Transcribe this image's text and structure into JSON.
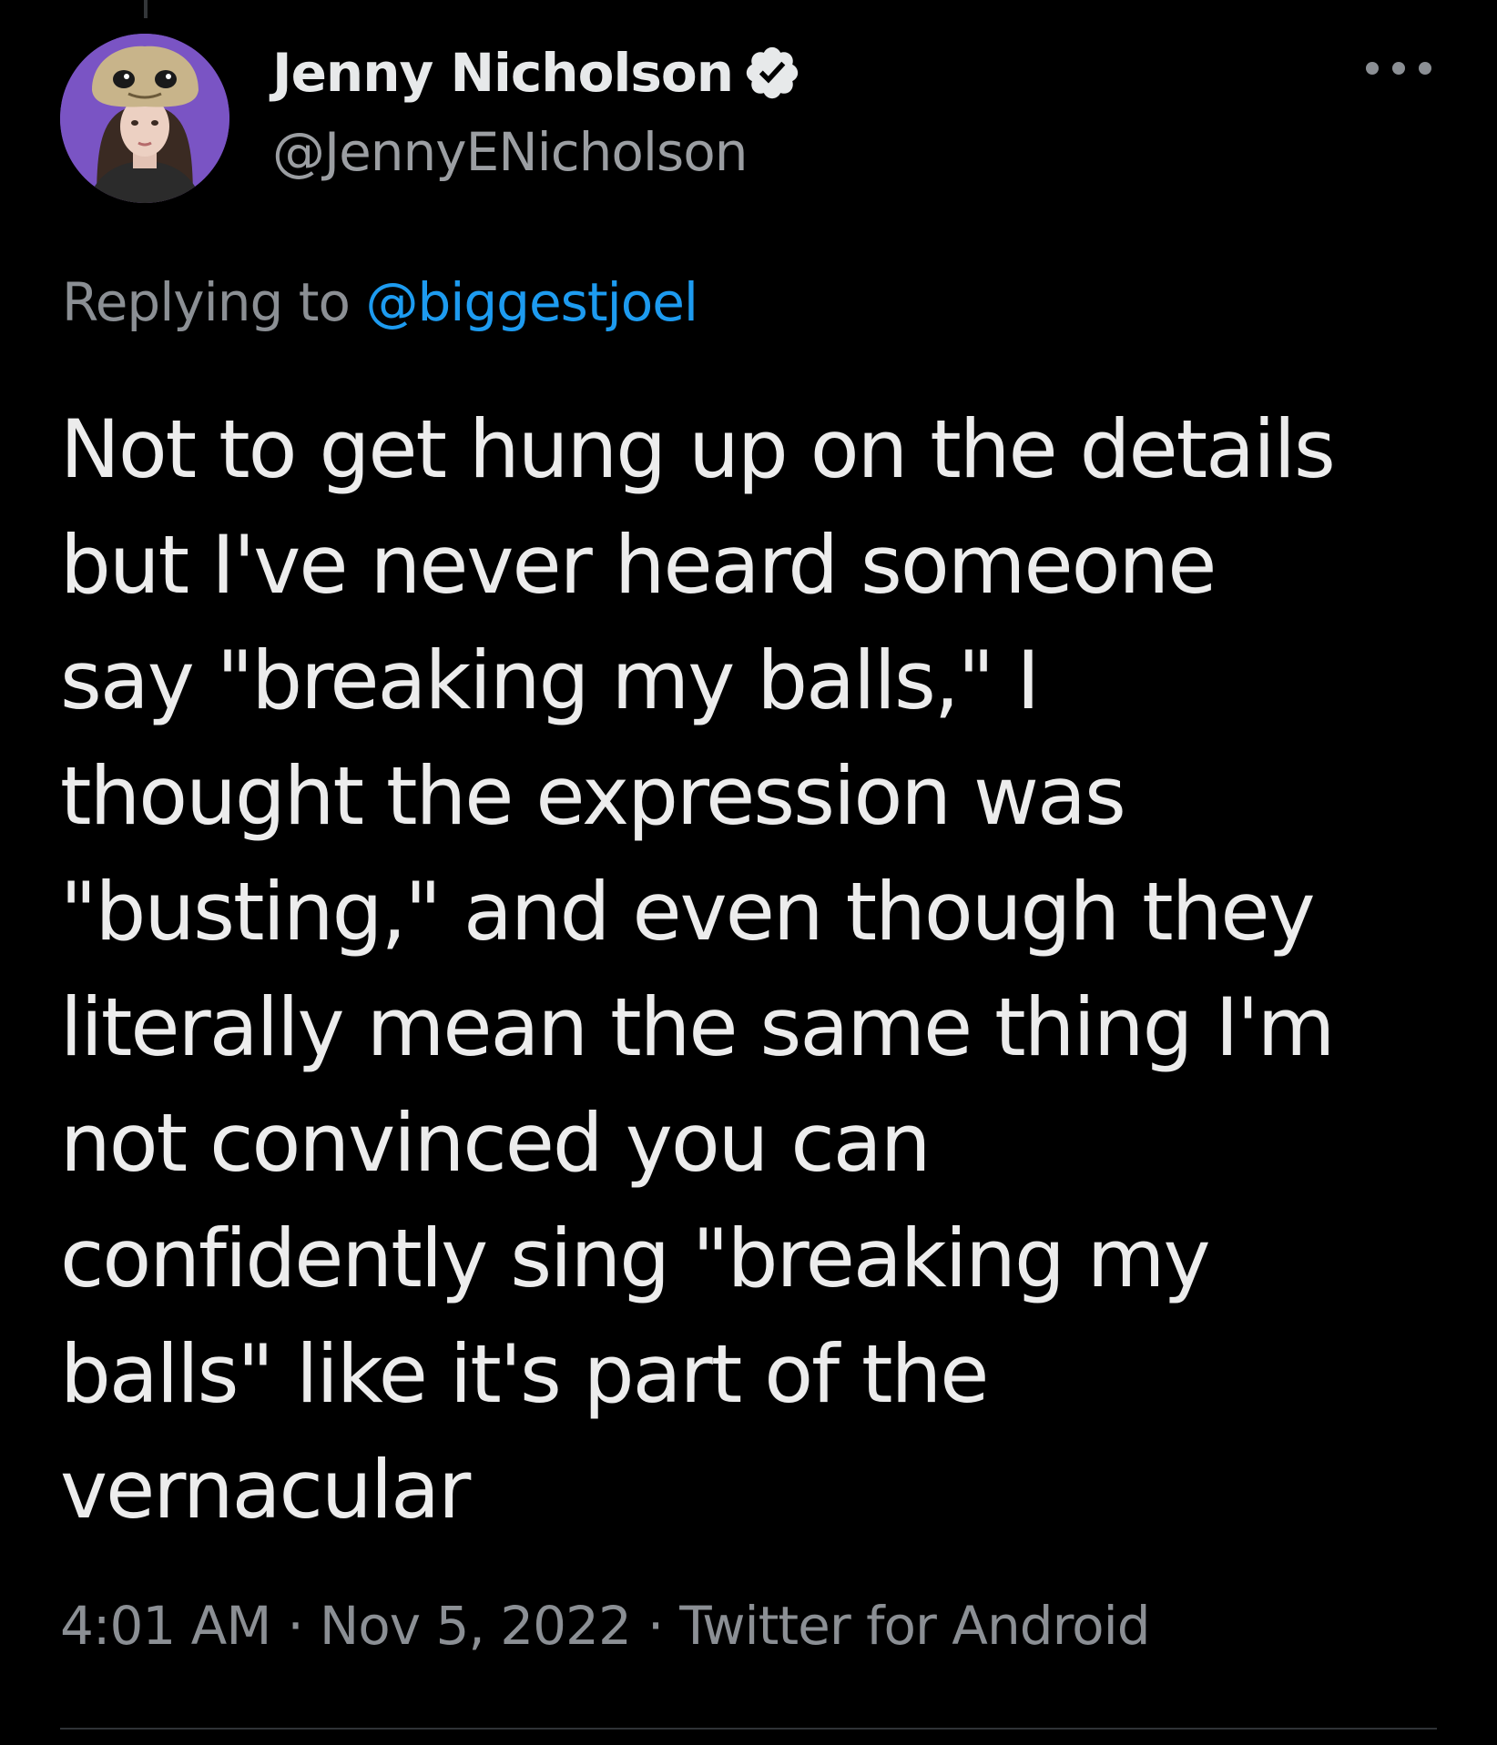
{
  "tweet": {
    "author": {
      "display_name": "Jenny Nicholson",
      "handle": "@JennyENicholson",
      "verified": true,
      "avatar_icon": "avatar"
    },
    "more_icon": "more-options-icon",
    "reply": {
      "prefix": "Replying to",
      "mention": "@biggestjoel"
    },
    "text_lines": [
      "Not to get hung up on the details",
      "but I've never heard someone",
      "say \"breaking my balls,\" I",
      "thought the expression was",
      "\"busting,\" and even though they",
      "literally mean the same thing I'm",
      "not convinced you can",
      "confidently sing \"breaking my",
      "balls\" like it's part of the",
      "vernacular"
    ],
    "meta": {
      "time": "4:01 AM",
      "date": "Nov 5, 2022",
      "source": "Twitter for Android",
      "separator": "·"
    }
  },
  "colors": {
    "background": "#000000",
    "text": "#e7e9ea",
    "secondary": "#8b8f94",
    "link": "#1d9bf0",
    "verified_badge": "#e7e9ea"
  }
}
